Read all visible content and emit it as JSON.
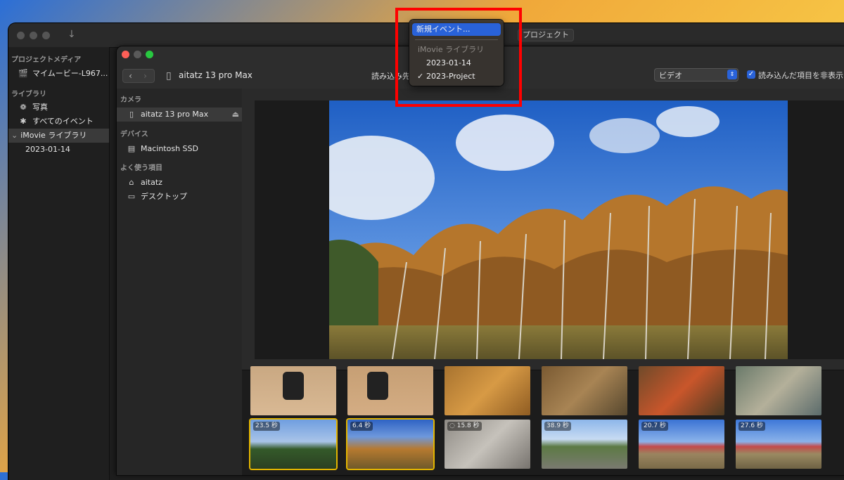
{
  "back_window": {
    "toolbar_label": "プロジェクト",
    "sidebar": {
      "project_media_header": "プロジェクトメディア",
      "project_item": "マイムービー-L967...",
      "library_header": "ライブラリ",
      "photos": "写真",
      "all_events": "すべてのイベント",
      "imovie_library": "iMovie ライブラリ",
      "event_date": "2023-01-14"
    }
  },
  "import_window": {
    "device_name": "aitatz 13 pro Max",
    "import_to_label": "読み込み先",
    "media_type": "ビデオ",
    "hide_imported_label": "読み込んだ項目を非表示",
    "hide_imported_checked": true,
    "sidebar": {
      "camera_header": "カメラ",
      "camera_item": "aitatz 13 pro Max",
      "devices_header": "デバイス",
      "device_item": "Macintosh SSD",
      "favorites_header": "よく使う項目",
      "fav_home": "aitatz",
      "fav_desktop": "デスクトップ"
    },
    "clips_row1": [
      "",
      "",
      "",
      "",
      "",
      ""
    ],
    "clips_row2": [
      "23.5 秒",
      "6.4 秒",
      "15.8 秒",
      "38.9 秒",
      "20.7 秒",
      "27.6 秒"
    ]
  },
  "dropdown_menu": {
    "items": [
      "新規イベント...",
      "iMovie ライブラリ",
      "2023-01-14",
      "2023-Project"
    ],
    "highlighted": "新規イベント...",
    "checked": "2023-Project",
    "checkmark": "✓"
  },
  "colors": {
    "highlight": "#2962d9",
    "red_annotation": "#ff0000",
    "selection_outline": "#e3b500"
  }
}
